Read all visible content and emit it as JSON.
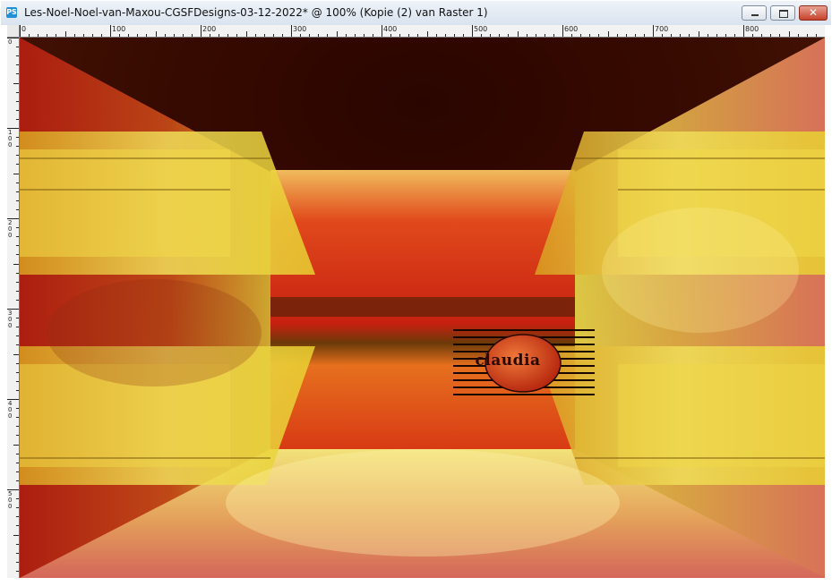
{
  "window": {
    "title": "Les-Noel-Noel-van-Maxou-CGSFDesigns-03-12-2022* @ 100% (Kopie (2) van Raster 1)",
    "app_icon_label": "PS",
    "buttons": {
      "minimize_icon": "minimize-icon",
      "maximize_icon": "maximize-icon",
      "close_glyph": "✕"
    }
  },
  "ruler_top": {
    "labels": [
      "0",
      "100",
      "200",
      "300",
      "400",
      "500",
      "600",
      "700",
      "800"
    ]
  },
  "ruler_left": {
    "labels": [
      "0",
      "100",
      "200",
      "300",
      "400",
      "500"
    ]
  },
  "canvas": {
    "description_colors": {
      "red": "#d2301a",
      "yellow": "#e8d84a",
      "dark": "#3a0e02",
      "pink": "#d86a60"
    }
  },
  "watermark": {
    "text": "claudia"
  }
}
